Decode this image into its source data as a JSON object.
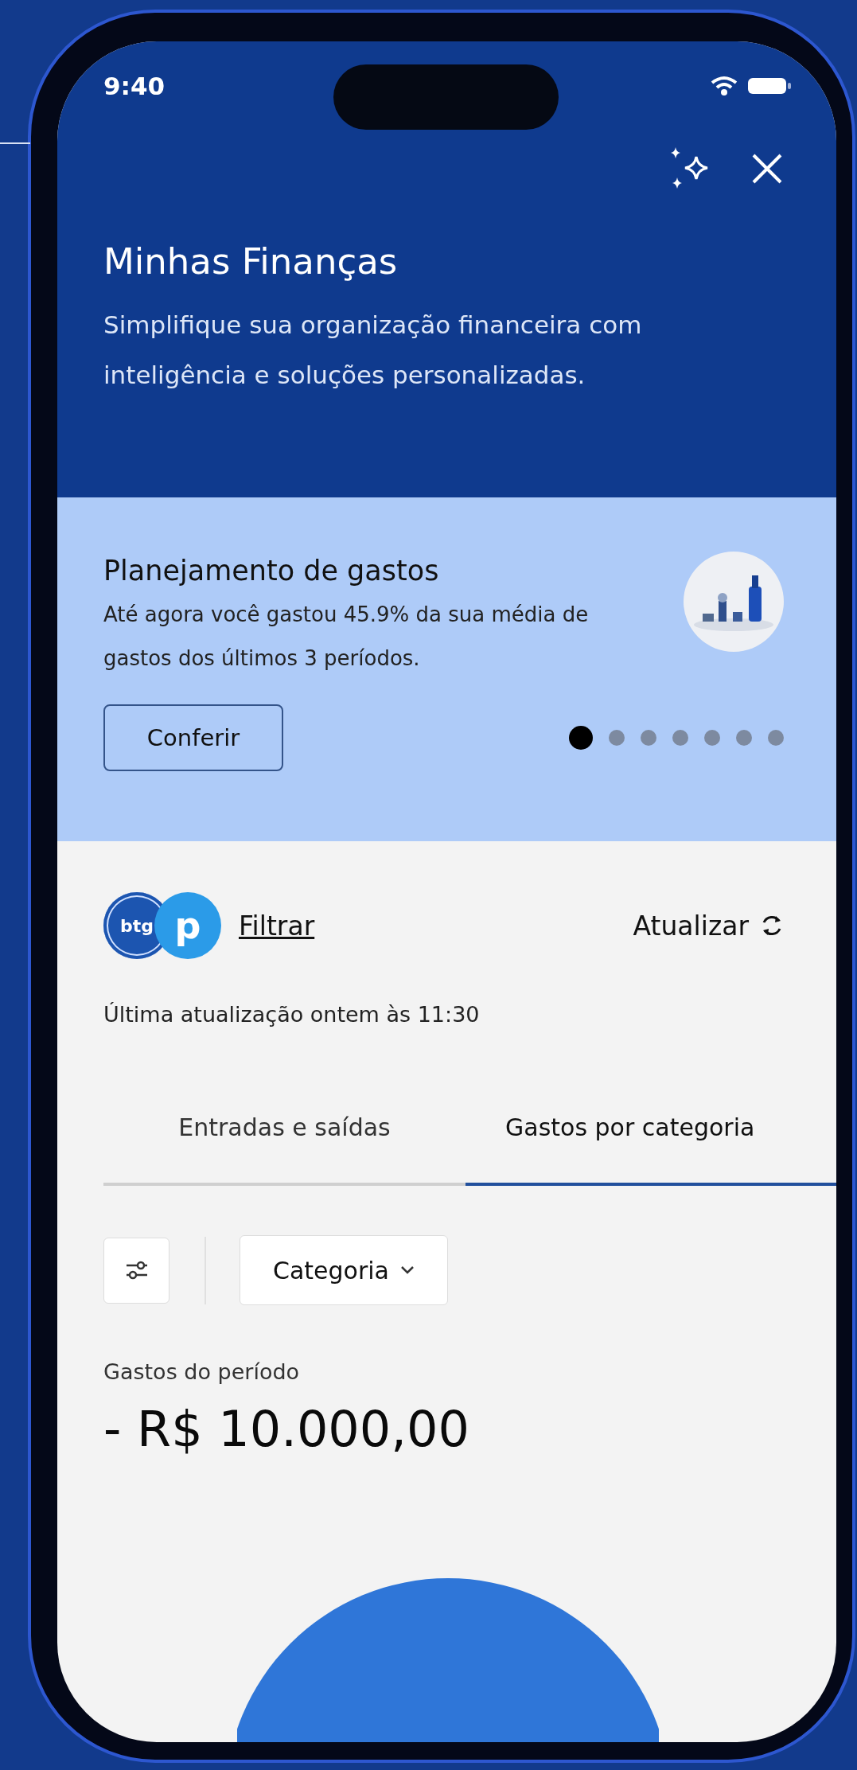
{
  "status_bar": {
    "time": "9:40"
  },
  "header": {
    "title": "Minhas Finanças",
    "subtitle": "Simplifique sua organização financeira com inteligência e soluções personalizadas."
  },
  "promo_card": {
    "title": "Planejamento de gastos",
    "text": "Até agora você gastou 45.9% da sua média de gastos dos últimos 3 períodos.",
    "button": "Conferir",
    "kind": "picture",
    "dots": [
      {
        "selected": true
      },
      {
        "selected": false
      },
      {
        "selected": false
      },
      {
        "selected": false
      },
      {
        "selected": false
      },
      {
        "selected": false
      },
      {
        "selected": false
      }
    ]
  },
  "toolbar": {
    "logo": [
      "btg",
      "p"
    ],
    "filter_link": "Filtrar",
    "refresh": "Atualizar",
    "last_update": "Última atualização ontem às 11:30"
  },
  "tabs": [
    {
      "label": "Entradas e saídas",
      "selected": false
    },
    {
      "label": "Gastos por categoria",
      "selected": true
    }
  ],
  "filters": {
    "dropdown": "Categoria"
  },
  "summary": {
    "label": "Gastos do período",
    "amount": "- R$ 10.000,00"
  }
}
